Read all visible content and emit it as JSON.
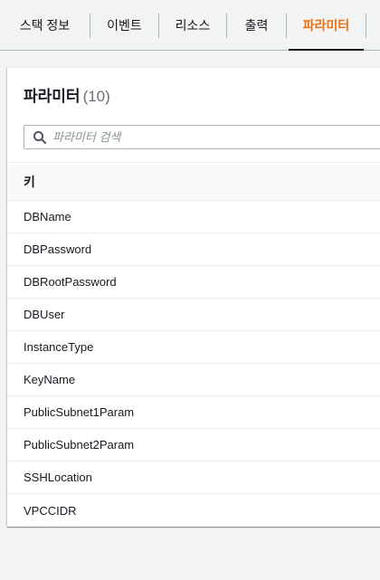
{
  "tabs": [
    {
      "label": "스택 정보",
      "active": false
    },
    {
      "label": "이벤트",
      "active": false
    },
    {
      "label": "리소스",
      "active": false
    },
    {
      "label": "출력",
      "active": false
    },
    {
      "label": "파라미터",
      "active": true
    }
  ],
  "panel": {
    "title": "파라미터",
    "count": "(10)"
  },
  "search": {
    "placeholder": "파라미터 검색",
    "value": ""
  },
  "table": {
    "columns": [
      "키"
    ],
    "rows": [
      "DBName",
      "DBPassword",
      "DBRootPassword",
      "DBUser",
      "InstanceType",
      "KeyName",
      "PublicSubnet1Param",
      "PublicSubnet2Param",
      "SSHLocation",
      "VPCCIDR"
    ]
  },
  "colors": {
    "accent": "#ec7211",
    "background": "#f2f3f3",
    "panel": "#ffffff",
    "divider": "#eaeded"
  }
}
